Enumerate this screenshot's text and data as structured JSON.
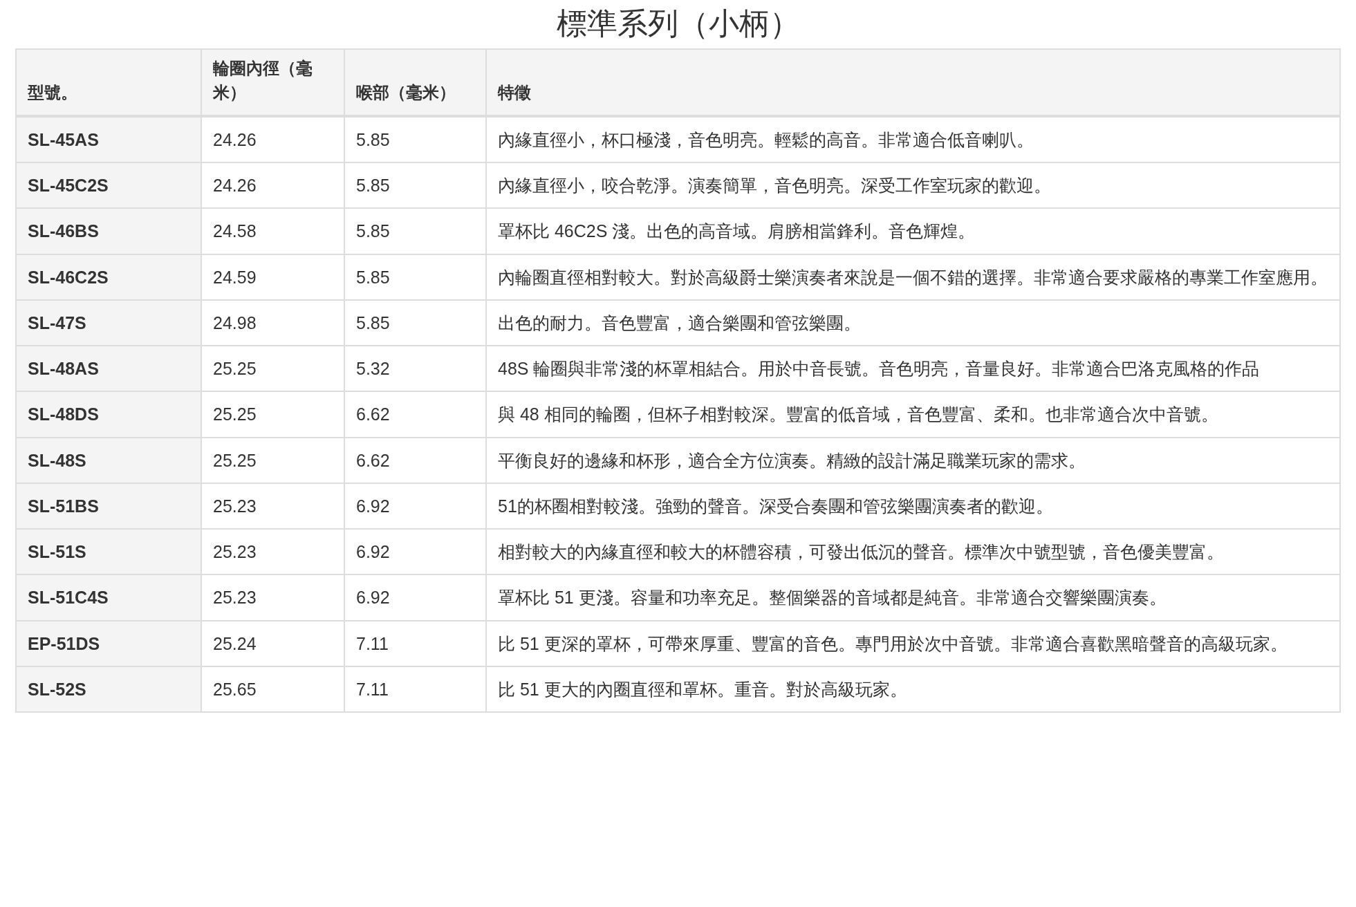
{
  "title": "標準系列（小柄）",
  "table": {
    "columns": [
      "型號。",
      "輪圈內徑（毫米）",
      "喉部（毫米）",
      "特徵"
    ],
    "rows": [
      [
        "SL-45AS",
        "24.26",
        "5.85",
        "內緣直徑小，杯口極淺，音色明亮。輕鬆的高音。非常適合低音喇叭。"
      ],
      [
        "SL-45C2S",
        "24.26",
        "5.85",
        "內緣直徑小，咬合乾淨。演奏簡單，音色明亮。深受工作室玩家的歡迎。"
      ],
      [
        "SL-46BS",
        "24.58",
        "5.85",
        "罩杯比 46C2S 淺。出色的高音域。肩膀相當鋒利。音色輝煌。"
      ],
      [
        "SL-46C2S",
        "24.59",
        "5.85",
        "內輪圈直徑相對較大。對於高級爵士樂演奏者來說是一個不錯的選擇。非常適合要求嚴格的專業工作室應用。"
      ],
      [
        "SL-47S",
        "24.98",
        "5.85",
        "出色的耐力。音色豐富，適合樂團和管弦樂團。"
      ],
      [
        "SL-48AS",
        "25.25",
        "5.32",
        "48S 輪圈與非常淺的杯罩相結合。用於中音長號。音色明亮，音量良好。非常適合巴洛克風格的作品"
      ],
      [
        "SL-48DS",
        "25.25",
        "6.62",
        "與 48 相同的輪圈，但杯子相對較深。豐富的低音域，音色豐富、柔和。也非常適合次中音號。"
      ],
      [
        "SL-48S",
        "25.25",
        "6.62",
        "平衡良好的邊緣和杯形，適合全方位演奏。精緻的設計滿足職業玩家的需求。"
      ],
      [
        "SL-51BS",
        "25.23",
        "6.92",
        "51的杯圈相對較淺。強勁的聲音。深受合奏團和管弦樂團演奏者的歡迎。"
      ],
      [
        "SL-51S",
        "25.23",
        "6.92",
        "相對較大的內緣直徑和較大的杯體容積，可發出低沉的聲音。標準次中號型號，音色優美豐富。"
      ],
      [
        "SL-51C4S",
        "25.23",
        "6.92",
        "罩杯比 51 更淺。容量和功率充足。整個樂器的音域都是純音。非常適合交響樂團演奏。"
      ],
      [
        "EP-51DS",
        "25.24",
        "7.11",
        "比 51 更深的罩杯，可帶來厚重、豐富的音色。專門用於次中音號。非常適合喜歡黑暗聲音的高級玩家。"
      ],
      [
        "SL-52S",
        "25.65",
        "7.11",
        "比 51 更大的內圈直徑和罩杯。重音。對於高級玩家。"
      ]
    ]
  }
}
